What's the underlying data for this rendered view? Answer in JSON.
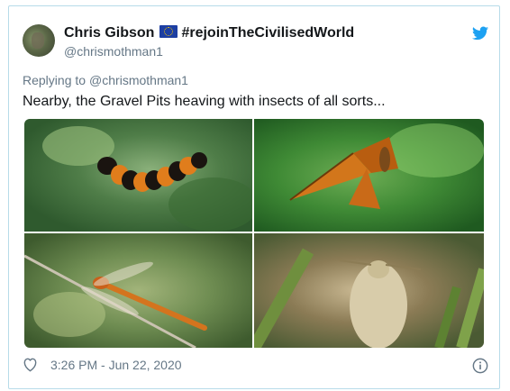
{
  "tweet": {
    "author_name": "Chris Gibson",
    "author_badge": "#rejoinTheCivilisedWorld",
    "handle": "@chrismothman1",
    "reply_prefix": "Replying to",
    "reply_to": "@chrismothman1",
    "text": "Nearby, the Gravel Pits heaving with insects of all sorts...",
    "timestamp": "3:26 PM - Jun 22, 2020"
  },
  "photos": [
    {
      "subject": "caterpillar"
    },
    {
      "subject": "skipper-butterfly"
    },
    {
      "subject": "dragonfly"
    },
    {
      "subject": "moth"
    }
  ],
  "icons": {
    "flag": "eu-flag-icon",
    "bird": "twitter-bird-icon",
    "like": "heart-icon",
    "info": "info-icon"
  },
  "colors": {
    "accent": "#1da1f2",
    "border": "#b7dbe9",
    "muted": "#657786",
    "text": "#14171a"
  }
}
